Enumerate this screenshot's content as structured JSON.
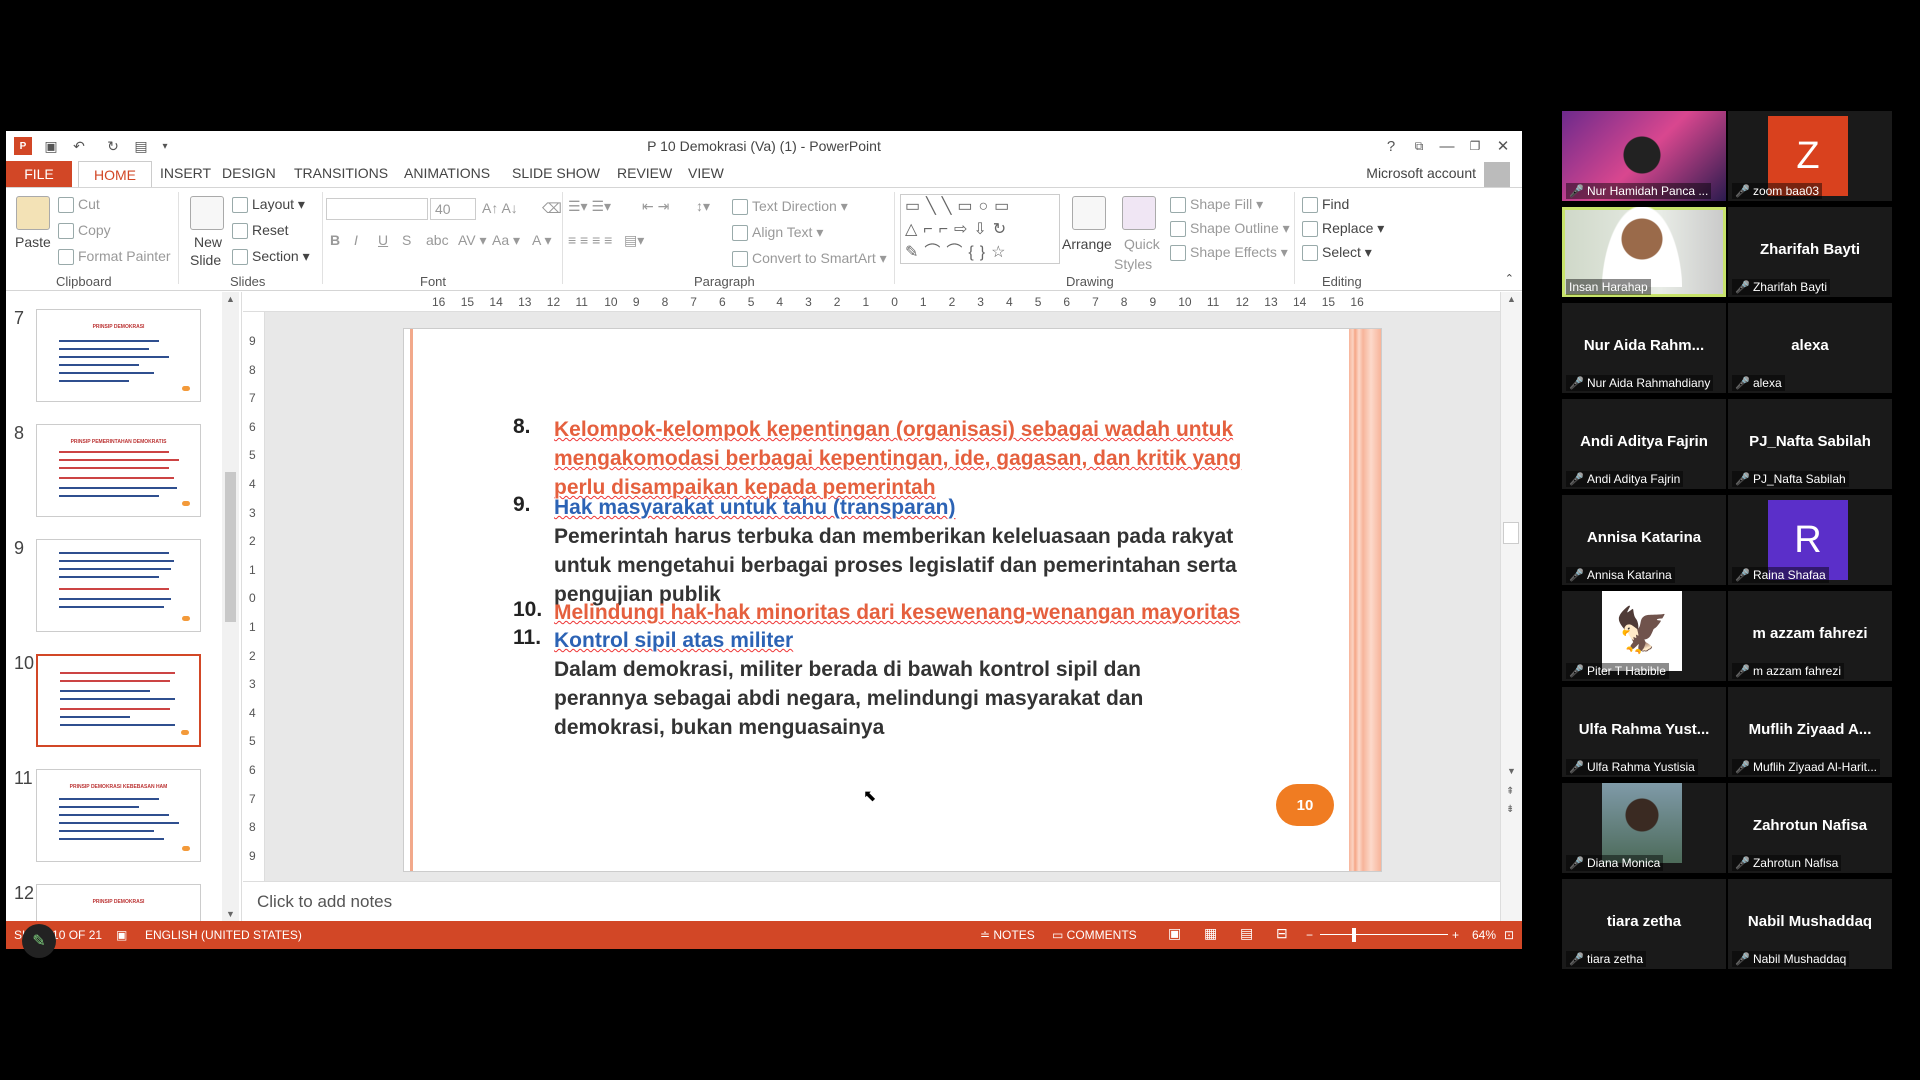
{
  "window": {
    "title": "P 10 Demokrasi (Va) (1) - PowerPoint",
    "account": "Microsoft account"
  },
  "tabs": [
    "FILE",
    "HOME",
    "INSERT",
    "DESIGN",
    "TRANSITIONS",
    "ANIMATIONS",
    "SLIDE SHOW",
    "REVIEW",
    "VIEW"
  ],
  "ribbon": {
    "clipboard": {
      "label": "Clipboard",
      "paste": "Paste",
      "cut": "Cut",
      "copy": "Copy",
      "format_painter": "Format Painter"
    },
    "slides": {
      "label": "Slides",
      "new_slide": "New",
      "new_slide2": "Slide",
      "layout": "Layout",
      "reset": "Reset",
      "section": "Section"
    },
    "font": {
      "label": "Font",
      "size": "40"
    },
    "paragraph": {
      "label": "Paragraph",
      "text_direction": "Text Direction",
      "align_text": "Align Text",
      "convert": "Convert to SmartArt"
    },
    "drawing": {
      "label": "Drawing",
      "arrange": "Arrange",
      "quick": "Quick",
      "styles": "Styles",
      "shape_fill": "Shape Fill",
      "shape_outline": "Shape Outline",
      "shape_effects": "Shape Effects"
    },
    "editing": {
      "label": "Editing",
      "find": "Find",
      "replace": "Replace",
      "select": "Select"
    }
  },
  "thumbnails": [
    {
      "num": "7",
      "title": "PRINSIP DEMOKRASI"
    },
    {
      "num": "8",
      "title": "PRINSIP PEMERINTAHAN DEMOKRATIS"
    },
    {
      "num": "9",
      "title": ""
    },
    {
      "num": "10",
      "title": ""
    },
    {
      "num": "11",
      "title": "PRINSIP DEMOKRASI KEBEBASAN HAM"
    },
    {
      "num": "12",
      "title": "PRINSIP DEMOKRASI"
    }
  ],
  "hruler": [
    "16",
    "15",
    "14",
    "13",
    "12",
    "11",
    "10",
    "9",
    "8",
    "7",
    "6",
    "5",
    "4",
    "3",
    "2",
    "1",
    "0",
    "1",
    "2",
    "3",
    "4",
    "5",
    "6",
    "7",
    "8",
    "9",
    "10",
    "11",
    "12",
    "13",
    "14",
    "15",
    "16"
  ],
  "vruler": [
    "9",
    "8",
    "7",
    "6",
    "5",
    "4",
    "3",
    "2",
    "1",
    "0",
    "1",
    "2",
    "3",
    "4",
    "5",
    "6",
    "7",
    "8",
    "9"
  ],
  "slide": {
    "items": [
      {
        "num": "8.",
        "text": "Kelompok-kelompok kepentingan (organisasi) sebagai wadah untuk mengakomodasi berbagai kepentingan, ide, gagasan, dan kritik yang perlu disampaikan kepada pemerintah"
      },
      {
        "num": "9.",
        "text": "Hak masyarakat untuk tahu (transparan)"
      },
      {
        "num": "",
        "text": "Pemerintah harus terbuka dan memberikan keleluasaan pada rakyat untuk mengetahui berbagai proses legislatif dan pemerintahan serta pengujian publik"
      },
      {
        "num": "10.",
        "text": "Melindungi hak-hak minoritas dari kesewenang-wenangan mayoritas"
      },
      {
        "num": "11.",
        "text": "Kontrol sipil atas militer"
      },
      {
        "num": "",
        "text": "Dalam demokrasi, militer berada di bawah kontrol sipil dan perannya sebagai abdi negara, melindungi masyarakat dan demokrasi, bukan menguasainya"
      }
    ],
    "page_number": "10"
  },
  "notes_placeholder": "Click to add notes",
  "status": {
    "slide_info": "SLIDE 10 OF 21",
    "language": "ENGLISH (UNITED STATES)",
    "notes": "NOTES",
    "comments": "COMMENTS",
    "zoom": "64%"
  },
  "participants": [
    {
      "name": "",
      "label": "Nur Hamidah Panca ...",
      "type": "photo"
    },
    {
      "name": "Z",
      "label": "zoom baa03",
      "type": "letter",
      "color": "#d9411e"
    },
    {
      "name": "",
      "label": "Insan Harahap",
      "type": "video",
      "active": true
    },
    {
      "name": "Zharifah Bayti",
      "label": "Zharifah Bayti",
      "type": "text"
    },
    {
      "name": "Nur Aida Rahm...",
      "label": "Nur Aida Rahmahdiany",
      "type": "text"
    },
    {
      "name": "alexa",
      "label": "alexa",
      "type": "text"
    },
    {
      "name": "Andi Aditya Fajrin",
      "label": "Andi Aditya Fajrin",
      "type": "text"
    },
    {
      "name": "PJ_Nafta Sabilah",
      "label": "PJ_Nafta Sabilah",
      "type": "text"
    },
    {
      "name": "Annisa Katarina",
      "label": "Annisa Katarina",
      "type": "text"
    },
    {
      "name": "R",
      "label": "Raina Shafaa",
      "type": "letter",
      "color": "#5b2fc9"
    },
    {
      "name": "",
      "label": "Piter T Habible",
      "type": "logo"
    },
    {
      "name": "m azzam fahrezi",
      "label": "m azzam fahrezi",
      "type": "text"
    },
    {
      "name": "Ulfa Rahma Yust...",
      "label": "Ulfa Rahma Yustisia",
      "type": "text"
    },
    {
      "name": "Muflih Ziyaad A...",
      "label": "Muflih Ziyaad Al-Harit...",
      "type": "text"
    },
    {
      "name": "",
      "label": "Diana Monica",
      "type": "photo2"
    },
    {
      "name": "Zahrotun Nafisa",
      "label": "Zahrotun Nafisa",
      "type": "text"
    },
    {
      "name": "tiara zetha",
      "label": "tiara zetha",
      "type": "text"
    },
    {
      "name": "Nabil Mushaddaq",
      "label": "Nabil Mushaddaq",
      "type": "text"
    }
  ]
}
